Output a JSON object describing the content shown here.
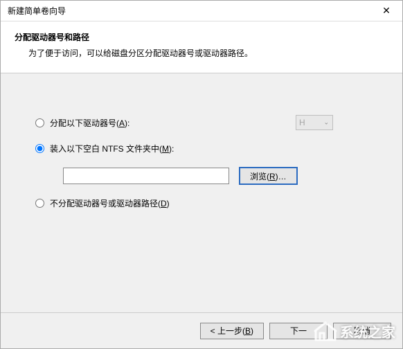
{
  "titlebar": {
    "title": "新建简单卷向导"
  },
  "header": {
    "title": "分配驱动器号和路径",
    "description": "为了便于访问，可以给磁盘分区分配驱动器号或驱动器路径。"
  },
  "options": {
    "assign_letter": {
      "label_pre": "分配以下驱动器号(",
      "hotkey": "A",
      "label_post": "):",
      "selected_letter": "H"
    },
    "mount_path": {
      "label_pre": "装入以下空白 NTFS 文件夹中(",
      "hotkey": "M",
      "label_post": "):",
      "path_value": "",
      "browse_pre": "浏览(",
      "browse_hotkey": "R",
      "browse_post": ")…"
    },
    "no_assign": {
      "label_pre": "不分配驱动器号或驱动器路径(",
      "hotkey": "D",
      "label_post": ")"
    },
    "selected": "mount_path"
  },
  "footer": {
    "back_pre": "< 上一步(",
    "back_hotkey": "B",
    "back_post": ")",
    "next_pre": "下一",
    "next_post": "",
    "cancel": "取消"
  },
  "watermark": {
    "text": "系统之家"
  }
}
